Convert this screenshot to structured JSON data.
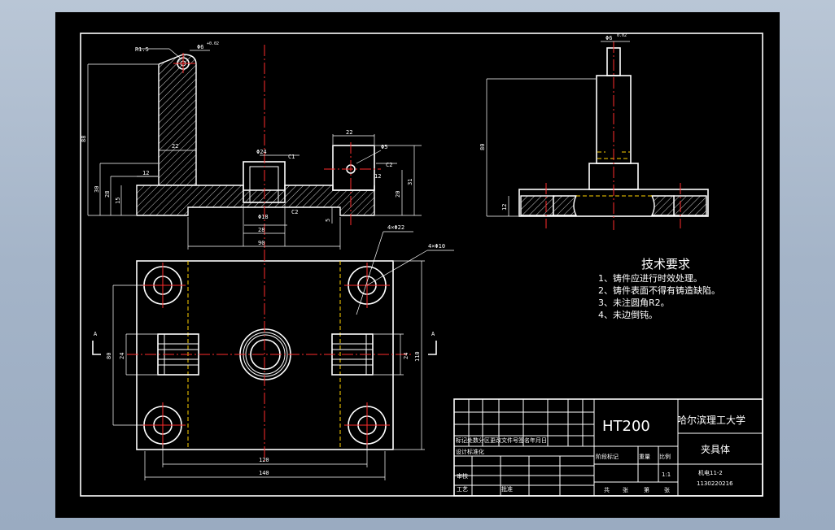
{
  "colors": {
    "background": "#000000",
    "outline": "#ffffff",
    "centerline": "#ff2b2b",
    "hidden_line": "#ffd200",
    "window_bg": "#a4b4c8"
  },
  "front_view": {
    "dims": {
      "r_top": "R1.5",
      "hole_top": "Φ6",
      "hole_top_tol": "+0.02",
      "height_88": "88",
      "height_30": "30",
      "height_28": "28",
      "height_15": "15",
      "width_22": "22",
      "width_12": "12",
      "boss_dia": "Φ24",
      "chamfer_c1": "C1",
      "bore_dia": "Φ18",
      "chamfer_c2a": "C2",
      "width_28": "28",
      "width_90": "90",
      "small_block_22": "22",
      "small_hole": "Φ5",
      "chamfer_c2b": "C2",
      "width_12b": "12",
      "height_20": "20",
      "height_31": "31",
      "height_5": "5"
    }
  },
  "side_view": {
    "dims": {
      "pin_dia": "Φ6",
      "pin_tol": "0.02",
      "height_80": "80",
      "height_12": "12"
    }
  },
  "top_view": {
    "dims": {
      "holes_22": "4×Φ22",
      "holes_10": "4×Φ10",
      "section_a_left": "A",
      "section_a_right": "A",
      "w_80": "80",
      "w_24": "24",
      "w_24b": "24",
      "w_110": "110",
      "w_120": "120",
      "w_140": "140"
    }
  },
  "tech_requirements": {
    "title": "技术要求",
    "items": [
      "1、铸件应进行时效处理。",
      "2、铸件表面不得有铸造缺陷。",
      "3、未注圆角R2。",
      "4、未边倒钝。"
    ]
  },
  "title_block": {
    "material": "HT200",
    "university": "哈尔滨理工大学",
    "part_name": "夹具体",
    "scale": "1:1",
    "class": "机电11-2",
    "student_id": "1130220216",
    "row_header": "标记处数分区更改文件号签名年月日",
    "design_row": "设计标准化",
    "stage_label": "阶段标记",
    "weight_label": "重量",
    "scale_label": "比例",
    "review_label": "审核",
    "process_label": "工艺",
    "approve_label": "批准",
    "sheets_total": "共",
    "sheets_unit": "张",
    "sheet_no": "第",
    "sheet_unit": "张"
  }
}
